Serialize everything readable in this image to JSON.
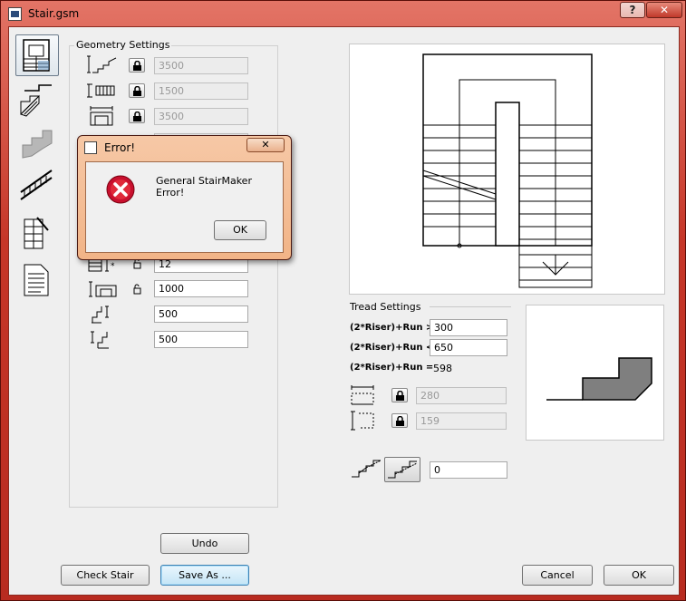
{
  "window": {
    "title": "Stair.gsm",
    "help_label": "?",
    "close_label": "✕"
  },
  "nav": [
    {
      "name": "nav-plan-view",
      "selected": true
    },
    {
      "name": "nav-section-view"
    },
    {
      "name": "nav-3d-stair"
    },
    {
      "name": "nav-railing"
    },
    {
      "name": "nav-materials"
    },
    {
      "name": "nav-document"
    }
  ],
  "geometry": {
    "title": "Geometry Settings",
    "rows": [
      {
        "value": "3500"
      },
      {
        "value": "1500"
      },
      {
        "value": "3500"
      },
      {
        "value": ""
      }
    ]
  },
  "riser": {
    "rows": [
      {
        "value": ""
      },
      {
        "value": "12"
      },
      {
        "value": "1000"
      },
      {
        "value": "500"
      },
      {
        "value": "500"
      }
    ]
  },
  "tread": {
    "title": "Tread Settings",
    "rule_gt_label": "(2*Riser)+Run >",
    "rule_gt_value": "300",
    "rule_lt_label": "(2*Riser)+Run <",
    "rule_lt_value": "650",
    "rule_eq_label": "(2*Riser)+Run =",
    "rule_eq_value": "598",
    "tread_depth": "280",
    "riser_height": "159",
    "nosing_value": "0"
  },
  "buttons": {
    "undo": "Undo",
    "check_stair": "Check Stair",
    "save_as": "Save As ...",
    "cancel": "Cancel",
    "ok": "OK"
  },
  "dialog": {
    "title": "Error!",
    "message": "General StairMaker Error!",
    "ok": "OK",
    "close": "✕"
  }
}
